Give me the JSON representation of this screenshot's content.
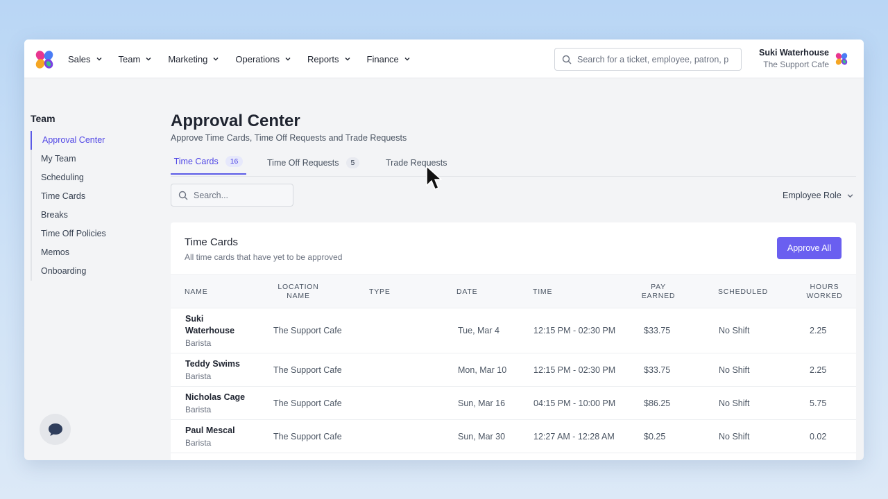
{
  "nav": {
    "items": [
      {
        "label": "Sales"
      },
      {
        "label": "Team"
      },
      {
        "label": "Marketing"
      },
      {
        "label": "Operations"
      },
      {
        "label": "Reports"
      },
      {
        "label": "Finance"
      }
    ],
    "search_placeholder": "Search for a ticket, employee, patron, p",
    "user_name": "Suki Waterhouse",
    "user_org": "The Support Cafe"
  },
  "sidebar": {
    "title": "Team",
    "items": [
      {
        "label": "Approval Center",
        "active": true
      },
      {
        "label": "My Team"
      },
      {
        "label": "Scheduling"
      },
      {
        "label": "Time Cards"
      },
      {
        "label": "Breaks"
      },
      {
        "label": "Time Off Policies"
      },
      {
        "label": "Memos"
      },
      {
        "label": "Onboarding"
      }
    ]
  },
  "page": {
    "title": "Approval Center",
    "subtitle": "Approve Time Cards, Time Off Requests and Trade Requests",
    "tabs": [
      {
        "label": "Time Cards",
        "count": "16",
        "active": true
      },
      {
        "label": "Time Off Requests",
        "count": "5"
      },
      {
        "label": "Trade Requests"
      }
    ],
    "search_placeholder": "Search...",
    "role_filter": "Employee Role"
  },
  "card": {
    "title": "Time Cards",
    "subtitle": "All time cards that have yet to be approved",
    "approve_all": "Approve All",
    "columns": {
      "name": "NAME",
      "location_1": "LOCATION",
      "location_2": "NAME",
      "type": "TYPE",
      "date": "DATE",
      "time": "TIME",
      "pay_1": "PAY",
      "pay_2": "EARNED",
      "scheduled": "SCHEDULED",
      "hours_1": "HOURS",
      "hours_2": "WORKED"
    },
    "rows": [
      {
        "name_1": "Suki",
        "name_2": "Waterhouse",
        "role": "Barista",
        "location": "The Support Cafe",
        "type": "",
        "date": "Tue, Mar 4",
        "time": "12:15 PM - 02:30 PM",
        "pay": "$33.75",
        "scheduled": "No Shift",
        "hours": "2.25"
      },
      {
        "name_1": "Teddy Swims",
        "name_2": "",
        "role": "Barista",
        "location": "The Support Cafe",
        "type": "",
        "date": "Mon, Mar 10",
        "time": "12:15 PM - 02:30 PM",
        "pay": "$33.75",
        "scheduled": "No Shift",
        "hours": "2.25"
      },
      {
        "name_1": "Nicholas Cage",
        "name_2": "",
        "role": "Barista",
        "location": "The Support Cafe",
        "type": "",
        "date": "Sun, Mar 16",
        "time": "04:15 PM - 10:00 PM",
        "pay": "$86.25",
        "scheduled": "No Shift",
        "hours": "5.75"
      },
      {
        "name_1": "Paul Mescal",
        "name_2": "",
        "role": "Barista",
        "location": "The Support Cafe",
        "type": "",
        "date": "Sun, Mar 30",
        "time": "12:27 AM - 12:28 AM",
        "pay": "$0.25",
        "scheduled": "No Shift",
        "hours": "0.02"
      }
    ]
  },
  "colors": {
    "accent": "#5b5be6",
    "button": "#6a5ff0"
  }
}
